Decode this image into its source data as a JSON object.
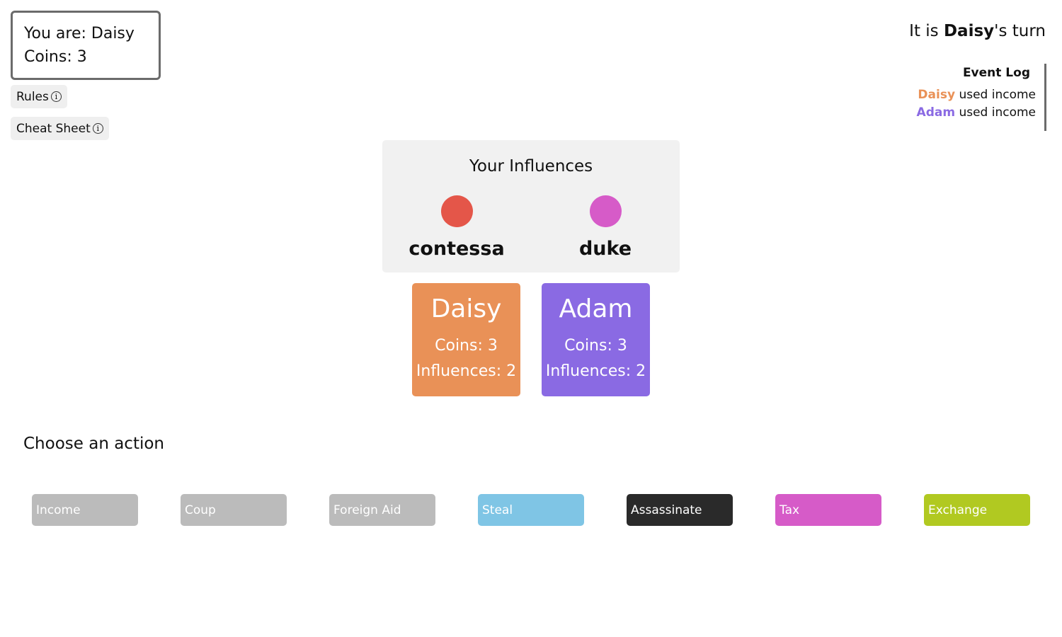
{
  "player_info": {
    "you_are": "You are: Daisy",
    "coins": "Coins: 3"
  },
  "buttons": {
    "rules": "Rules",
    "cheat_sheet": "Cheat Sheet",
    "info_glyph": "i"
  },
  "turn": {
    "prefix": "It is ",
    "name": "Daisy",
    "suffix": "'s turn"
  },
  "event_log": {
    "title": "Event Log",
    "entries": [
      {
        "who": "Daisy",
        "text": " used income",
        "color": "#e99157"
      },
      {
        "who": "Adam",
        "text": " used income",
        "color": "#8a6ae3"
      }
    ]
  },
  "influences": {
    "title": "Your Influences",
    "cards": [
      {
        "name": "contessa",
        "color": "#e45649"
      },
      {
        "name": "duke",
        "color": "#d65bc8"
      }
    ]
  },
  "players": [
    {
      "name": "Daisy",
      "coins": "Coins: 3",
      "influences": "Influences: 2",
      "color": "#e99157"
    },
    {
      "name": "Adam",
      "coins": "Coins: 3",
      "influences": "Influences: 2",
      "color": "#8a6ae3"
    }
  ],
  "actions": {
    "title": "Choose an action",
    "items": [
      {
        "label": "Income",
        "color": "#bbbbbb",
        "icon": ""
      },
      {
        "label": "Coup",
        "color": "#bbbbbb",
        "icon": ""
      },
      {
        "label": "Foreign Aid",
        "color": "#bbbbbb",
        "icon": ""
      },
      {
        "label": "Steal",
        "color": "#7fc5e5",
        "icon": ""
      },
      {
        "label": "Assassinate",
        "color": "#2a2a2a",
        "icon": ""
      },
      {
        "label": "Tax",
        "color": "#d65bc8",
        "icon": ""
      },
      {
        "label": "Exchange",
        "color": "#b1c921",
        "icon": ""
      }
    ]
  }
}
